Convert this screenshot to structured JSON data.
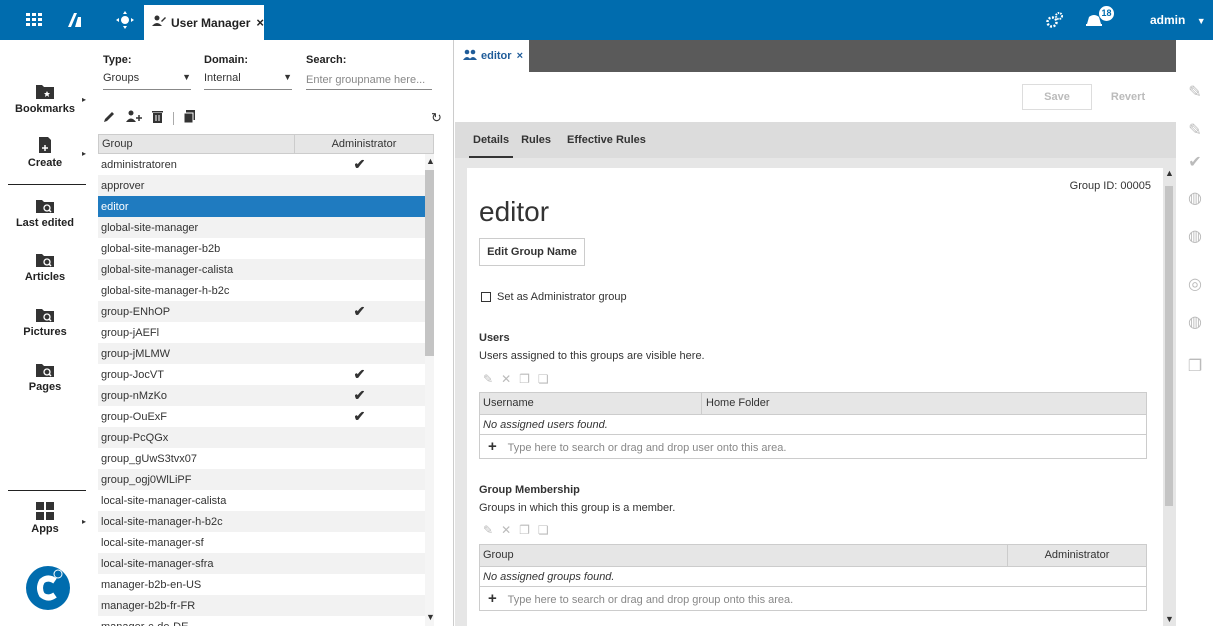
{
  "topbar": {
    "tab_label": "User Manager",
    "tab_close": "×",
    "notification_count": "18",
    "user_label": "admin"
  },
  "leftnav": {
    "items": [
      {
        "label": "Bookmarks",
        "icon": "bookmark-folder-icon"
      },
      {
        "label": "Create",
        "icon": "create-document-icon"
      },
      {
        "label": "Last edited",
        "icon": "search-folder-icon"
      },
      {
        "label": "Articles",
        "icon": "search-folder-icon"
      },
      {
        "label": "Pictures",
        "icon": "search-folder-icon"
      },
      {
        "label": "Pages",
        "icon": "search-folder-icon"
      },
      {
        "label": "Apps",
        "icon": "apps-grid-icon"
      }
    ]
  },
  "filters": {
    "type_label": "Type:",
    "type_value": "Groups",
    "domain_label": "Domain:",
    "domain_value": "Internal",
    "search_label": "Search:",
    "search_placeholder": "Enter groupname here..."
  },
  "group_table": {
    "col_group": "Group",
    "col_admin": "Administrator",
    "check": "✔",
    "rows": [
      {
        "name": "administratoren",
        "admin": true
      },
      {
        "name": "approver",
        "admin": false
      },
      {
        "name": "editor",
        "admin": false,
        "selected": true
      },
      {
        "name": "global-site-manager",
        "admin": false
      },
      {
        "name": "global-site-manager-b2b",
        "admin": false
      },
      {
        "name": "global-site-manager-calista",
        "admin": false
      },
      {
        "name": "global-site-manager-h-b2c",
        "admin": false
      },
      {
        "name": "group-ENhOP",
        "admin": true
      },
      {
        "name": "group-jAEFl",
        "admin": false
      },
      {
        "name": "group-jMLMW",
        "admin": false
      },
      {
        "name": "group-JocVT",
        "admin": true
      },
      {
        "name": "group-nMzKo",
        "admin": true
      },
      {
        "name": "group-OuExF",
        "admin": true
      },
      {
        "name": "group-PcQGx",
        "admin": false
      },
      {
        "name": "group_gUwS3tvx07",
        "admin": false
      },
      {
        "name": "group_ogj0WlLiPF",
        "admin": false
      },
      {
        "name": "local-site-manager-calista",
        "admin": false
      },
      {
        "name": "local-site-manager-h-b2c",
        "admin": false
      },
      {
        "name": "local-site-manager-sf",
        "admin": false
      },
      {
        "name": "local-site-manager-sfra",
        "admin": false
      },
      {
        "name": "manager-b2b-en-US",
        "admin": false
      },
      {
        "name": "manager-b2b-fr-FR",
        "admin": false
      },
      {
        "name": "manager-c-de-DE",
        "admin": false
      }
    ]
  },
  "workspace": {
    "tab_label": "editor",
    "tab_close": "×",
    "save_label": "Save",
    "revert_label": "Revert",
    "tabs": [
      "Details",
      "Rules",
      "Effective Rules"
    ],
    "group_id": "Group ID: 00005",
    "title": "editor",
    "edit_name_label": "Edit Group Name",
    "admin_checkbox_label": "Set as Administrator group",
    "users": {
      "title": "Users",
      "desc": "Users assigned to this groups are visible here.",
      "col_username": "Username",
      "col_home": "Home Folder",
      "empty": "No assigned users found.",
      "add_hint": "Type here to search or drag and drop user onto this area."
    },
    "membership": {
      "title": "Group Membership",
      "desc": "Groups in which this group is a member.",
      "col_group": "Group",
      "col_admin": "Administrator",
      "empty": "No assigned groups found.",
      "add_hint": "Type here to search or drag and drop group onto this area."
    }
  }
}
